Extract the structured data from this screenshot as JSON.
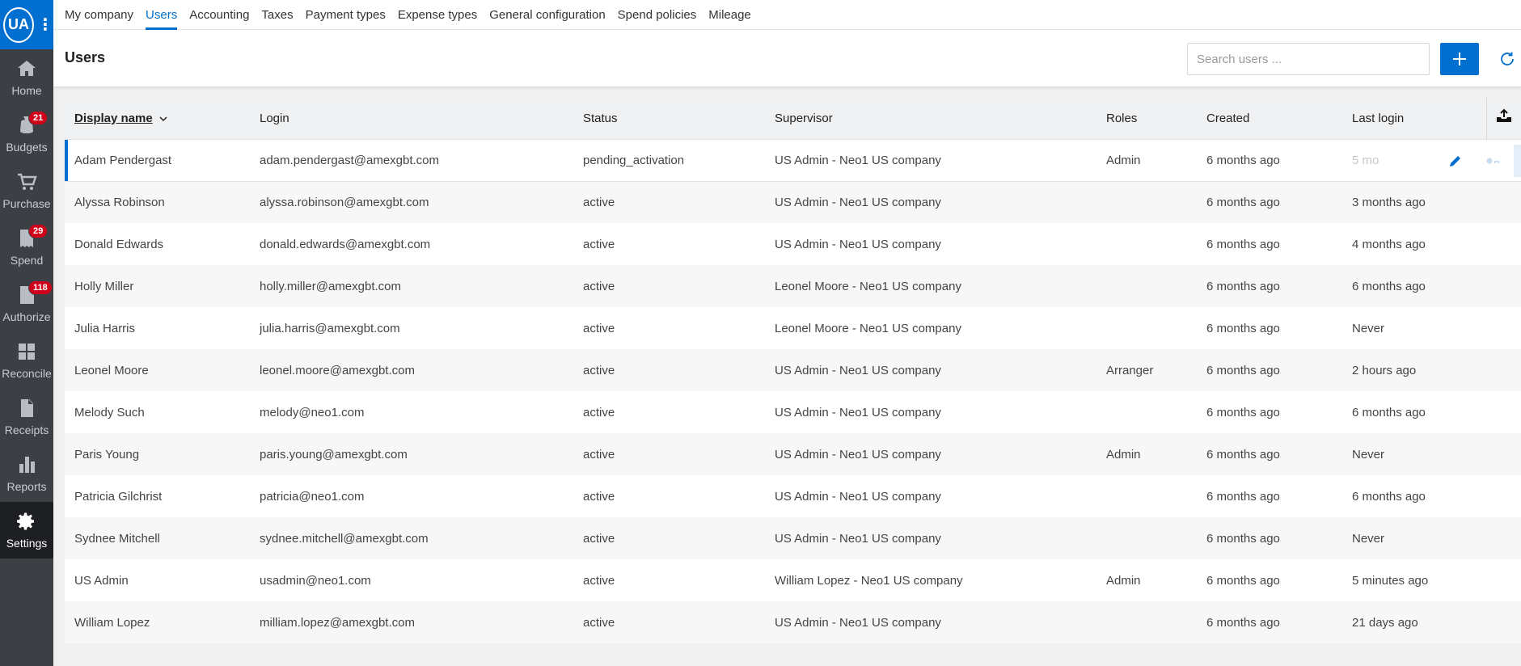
{
  "sidebar": {
    "avatar": "UA",
    "items": [
      {
        "label": "Home",
        "icon": "home-icon",
        "badge": ""
      },
      {
        "label": "Budgets",
        "icon": "money-bag-icon",
        "badge": "21"
      },
      {
        "label": "Purchase",
        "icon": "cart-icon",
        "badge": ""
      },
      {
        "label": "Spend",
        "icon": "receipt-list-icon",
        "badge": "29"
      },
      {
        "label": "Authorize",
        "icon": "approve-doc-icon",
        "badge": "118"
      },
      {
        "label": "Reconcile",
        "icon": "reconcile-icon",
        "badge": ""
      },
      {
        "label": "Receipts",
        "icon": "document-icon",
        "badge": ""
      },
      {
        "label": "Reports",
        "icon": "bar-chart-icon",
        "badge": ""
      },
      {
        "label": "Settings",
        "icon": "gear-icon",
        "badge": ""
      }
    ]
  },
  "tabs": [
    "My company",
    "Users",
    "Accounting",
    "Taxes",
    "Payment types",
    "Expense types",
    "General configuration",
    "Spend policies",
    "Mileage"
  ],
  "active_tab": "Users",
  "header": {
    "title": "Users",
    "search_placeholder": "Search users ..."
  },
  "table": {
    "columns": [
      "Display name",
      "Login",
      "Status",
      "Supervisor",
      "Roles",
      "Created",
      "Last login"
    ],
    "rows": [
      {
        "name": "Adam Pendergast",
        "login": "adam.pendergast@amexgbt.com",
        "status": "pending_activation",
        "supervisor": "US Admin - Neo1 US company",
        "roles": "Admin",
        "created": "6 months ago",
        "last": "5 mo"
      },
      {
        "name": "Alyssa Robinson",
        "login": "alyssa.robinson@amexgbt.com",
        "status": "active",
        "supervisor": "US Admin - Neo1 US company",
        "roles": "",
        "created": "6 months ago",
        "last": "3 months ago"
      },
      {
        "name": "Donald Edwards",
        "login": "donald.edwards@amexgbt.com",
        "status": "active",
        "supervisor": "US Admin - Neo1 US company",
        "roles": "",
        "created": "6 months ago",
        "last": "4 months ago"
      },
      {
        "name": "Holly Miller",
        "login": "holly.miller@amexgbt.com",
        "status": "active",
        "supervisor": "Leonel Moore - Neo1 US company",
        "roles": "",
        "created": "6 months ago",
        "last": "6 months ago"
      },
      {
        "name": "Julia Harris",
        "login": "julia.harris@amexgbt.com",
        "status": "active",
        "supervisor": "Leonel Moore - Neo1 US company",
        "roles": "",
        "created": "6 months ago",
        "last": "Never"
      },
      {
        "name": "Leonel Moore",
        "login": "leonel.moore@amexgbt.com",
        "status": "active",
        "supervisor": "US Admin - Neo1 US company",
        "roles": "Arranger",
        "created": "6 months ago",
        "last": "2 hours ago"
      },
      {
        "name": "Melody Such",
        "login": "melody@neo1.com",
        "status": "active",
        "supervisor": "US Admin - Neo1 US company",
        "roles": "",
        "created": "6 months ago",
        "last": "6 months ago"
      },
      {
        "name": "Paris Young",
        "login": "paris.young@amexgbt.com",
        "status": "active",
        "supervisor": "US Admin - Neo1 US company",
        "roles": "Admin",
        "created": "6 months ago",
        "last": "Never"
      },
      {
        "name": "Patricia Gilchrist",
        "login": "patricia@neo1.com",
        "status": "active",
        "supervisor": "US Admin - Neo1 US company",
        "roles": "",
        "created": "6 months ago",
        "last": "6 months ago"
      },
      {
        "name": "Sydnee Mitchell",
        "login": "sydnee.mitchell@amexgbt.com",
        "status": "active",
        "supervisor": "US Admin - Neo1 US company",
        "roles": "",
        "created": "6 months ago",
        "last": "Never"
      },
      {
        "name": "US Admin",
        "login": "usadmin@neo1.com",
        "status": "active",
        "supervisor": "William Lopez - Neo1 US company",
        "roles": "Admin",
        "created": "6 months ago",
        "last": "5 minutes ago"
      },
      {
        "name": "William Lopez",
        "login": "milliam.lopez@amexgbt.com",
        "status": "active",
        "supervisor": "US Admin - Neo1 US company",
        "roles": "",
        "created": "6 months ago",
        "last": "21 days ago"
      }
    ]
  },
  "colors": {
    "accent": "#006fcf",
    "badge": "#d0021b",
    "sidebar": "#3c3f44"
  }
}
